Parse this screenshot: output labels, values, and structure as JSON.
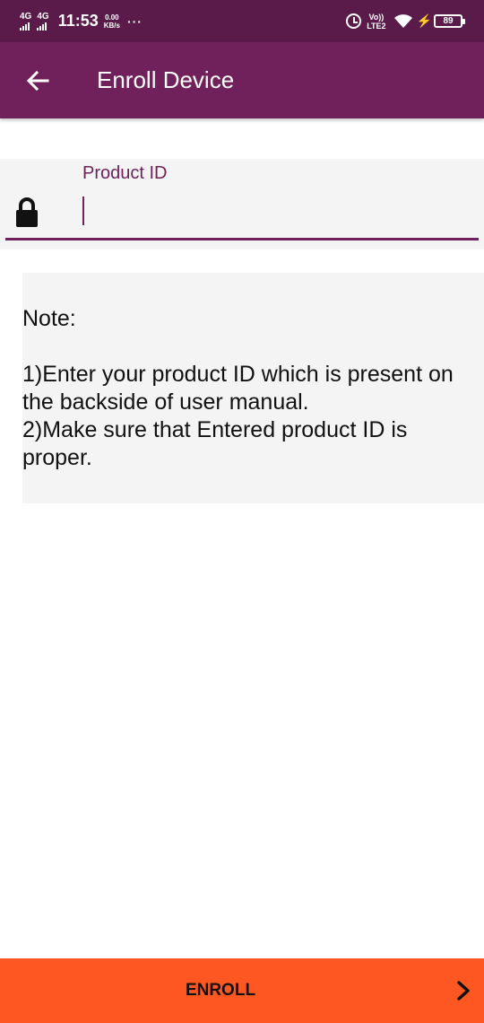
{
  "status_bar": {
    "net1_label": "4G",
    "net2_label": "4G",
    "time": "11:53",
    "speed_value": "0.00",
    "speed_unit": "KB/s",
    "more": "···",
    "volte_top": "Vo))",
    "volte_bottom": "LTE2",
    "battery": "89"
  },
  "app_bar": {
    "title": "Enroll Device",
    "back_icon": "arrow-left-icon"
  },
  "form": {
    "label": "Product ID",
    "value": "",
    "lock_icon": "lock-icon"
  },
  "note": {
    "title": "Note:",
    "lines": [
      "1)Enter your product ID which is present on the backside of user manual.",
      "2)Make sure that Entered product ID is proper."
    ]
  },
  "footer": {
    "button_label": "ENROLL",
    "chevron_icon": "chevron-right-icon"
  },
  "colors": {
    "status_bar": "#5a1a4a",
    "app_bar": "#70205b",
    "accent": "#70205b",
    "panel": "#f4f4f4",
    "enroll_button": "#ff5722"
  }
}
